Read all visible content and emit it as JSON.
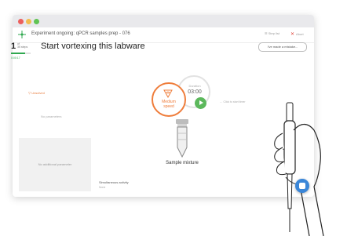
{
  "header": {
    "title": "Experiment ongoing: qPCR samples prep - 076",
    "step_button": "Step list",
    "abort_button": "Abort"
  },
  "step": {
    "number": "1",
    "of_label": "of",
    "total_label": "35 steps",
    "elapsed": "0:00:17",
    "progress": 0.7,
    "heading": "Start vortexing this labware"
  },
  "mistake_button": "I've made a mistake...",
  "left_panel": {
    "status": "Unsolved",
    "no_parameters": "No parameters",
    "no_additional": "No additional parameter"
  },
  "device": {
    "speed_label": "Medium speed",
    "timer_caption": "Duration",
    "timer_value": "03:00",
    "click_hint": "Click to start timer"
  },
  "labware": {
    "name": "Sample mixture"
  },
  "simultaneous": {
    "label": "Simultaneous activity",
    "value": "None"
  },
  "colors": {
    "accent_orange": "#ef7d3b",
    "success_green": "#5cb85c",
    "chat_blue": "#3a86d8"
  }
}
